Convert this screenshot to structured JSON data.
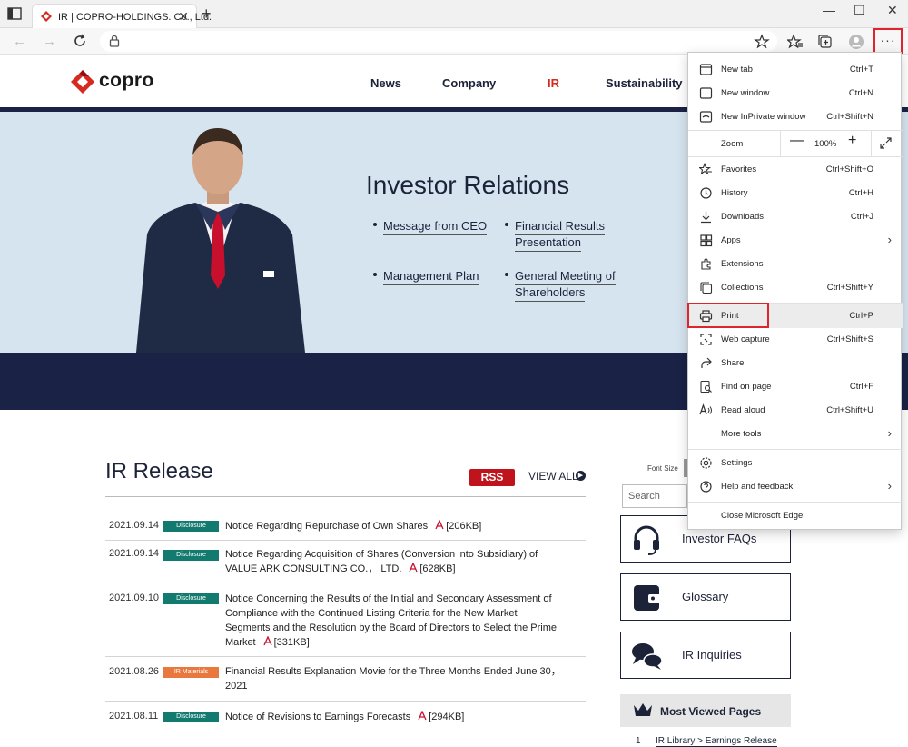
{
  "browser": {
    "tab_title": "IR | COPRO-HOLDINGS. Co., Ltd.",
    "tab_close": "✕",
    "new_tab": "+",
    "win_min": "—",
    "win_max": "☐",
    "win_close": "✕",
    "more_label": "···"
  },
  "site": {
    "logo_text": "copro",
    "nav": [
      "News",
      "Company",
      "IR",
      "Sustainability"
    ],
    "hero_title": "Investor Relations",
    "hero_links": [
      "Message from CEO",
      "Financial Results",
      "Presentation",
      "Management Plan",
      "General Meeting of",
      "Shareholders"
    ]
  },
  "ir": {
    "title": "IR Release",
    "rss": "RSS",
    "view_all": "VIEW ALL",
    "rows": [
      {
        "date": "2021.09.14",
        "tag": "Disclosure",
        "line1": "Notice Regarding Repurchase of Own Shares",
        "size": "[206KB]"
      },
      {
        "date": "2021.09.14",
        "tag": "Disclosure",
        "line1": "Notice Regarding Acquisition of Shares (Conversion into Subsidiary) of",
        "line2": "VALUE ARK CONSULTING CO.， LTD.",
        "size": "[628KB]"
      },
      {
        "date": "2021.09.10",
        "tag": "Disclosure",
        "line1": "Notice Concerning the Results of the Initial and Secondary Assessment of",
        "line2": "Compliance with the Continued Listing Criteria for the New Market",
        "line3": "Segments and the Resolution by the Board of Directors to Select the Prime",
        "line4": "Market",
        "size": "[331KB]"
      },
      {
        "date": "2021.08.26",
        "tag": "IR Materials",
        "line1": "Financial Results Explanation Movie for the Three Months Ended June 30，",
        "line2": "2021"
      },
      {
        "date": "2021.08.11",
        "tag": "Disclosure",
        "line1": "Notice of Revisions to Earnings Forecasts",
        "size": "[294KB]"
      }
    ]
  },
  "sidebar": {
    "font_size_label": "Font Size",
    "search_placeholder": "Search",
    "cards": [
      "Investor FAQs",
      "Glossary",
      "IR Inquiries"
    ],
    "most_viewed": "Most Viewed Pages",
    "mv_num": "1",
    "mv_item": "IR Library > Earnings Release"
  },
  "menu": {
    "items": [
      {
        "label": "New tab",
        "shortcut": "Ctrl+T"
      },
      {
        "label": "New window",
        "shortcut": "Ctrl+N"
      },
      {
        "label": "New InPrivate window",
        "shortcut": "Ctrl+Shift+N"
      },
      {
        "label": "Zoom",
        "shortcut": ""
      },
      {
        "label": "Favorites",
        "shortcut": "Ctrl+Shift+O"
      },
      {
        "label": "History",
        "shortcut": "Ctrl+H"
      },
      {
        "label": "Downloads",
        "shortcut": "Ctrl+J"
      },
      {
        "label": "Apps",
        "shortcut": ""
      },
      {
        "label": "Extensions",
        "shortcut": ""
      },
      {
        "label": "Collections",
        "shortcut": "Ctrl+Shift+Y"
      },
      {
        "label": "Print",
        "shortcut": "Ctrl+P"
      },
      {
        "label": "Web capture",
        "shortcut": "Ctrl+Shift+S"
      },
      {
        "label": "Share",
        "shortcut": ""
      },
      {
        "label": "Find on page",
        "shortcut": "Ctrl+F"
      },
      {
        "label": "Read aloud",
        "shortcut": "Ctrl+Shift+U"
      },
      {
        "label": "More tools",
        "shortcut": ""
      },
      {
        "label": "Settings",
        "shortcut": ""
      },
      {
        "label": "Help and feedback",
        "shortcut": ""
      },
      {
        "label": "Close Microsoft Edge",
        "shortcut": ""
      }
    ],
    "zoom_minus": "—",
    "zoom_value": "100%",
    "zoom_plus": "+"
  },
  "colors": {
    "navy": "#1a2346",
    "brand_red": "#d6291f",
    "disclosure": "#127a6e",
    "ir_materials": "#e9783e",
    "highlight": "#e0242e"
  }
}
